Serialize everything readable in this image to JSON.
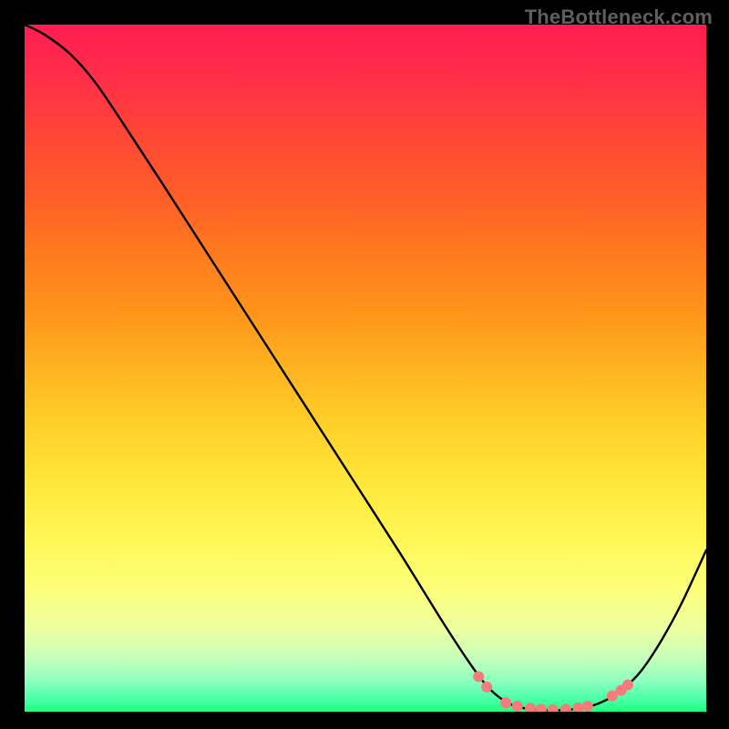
{
  "watermark": "TheBottleneck.com",
  "plot": {
    "x_extent": [
      0,
      748
    ],
    "y_extent": [
      0,
      754
    ]
  },
  "chart_data": {
    "type": "line",
    "title": "",
    "xlabel": "",
    "ylabel": "",
    "xlim": [
      0,
      100
    ],
    "ylim": [
      0,
      100
    ],
    "gradient_stops": [
      {
        "offset": 0.0,
        "color": "#ff1d52"
      },
      {
        "offset": 0.083,
        "color": "#ff2f47"
      },
      {
        "offset": 0.167,
        "color": "#ff4835"
      },
      {
        "offset": 0.25,
        "color": "#ff5e28"
      },
      {
        "offset": 0.333,
        "color": "#ff7a1e"
      },
      {
        "offset": 0.417,
        "color": "#ff941b"
      },
      {
        "offset": 0.5,
        "color": "#ffb321"
      },
      {
        "offset": 0.583,
        "color": "#ffd029"
      },
      {
        "offset": 0.667,
        "color": "#ffe73a"
      },
      {
        "offset": 0.75,
        "color": "#fff757"
      },
      {
        "offset": 0.82,
        "color": "#fdff78"
      },
      {
        "offset": 0.88,
        "color": "#ecffa0"
      },
      {
        "offset": 0.92,
        "color": "#c9ffba"
      },
      {
        "offset": 0.955,
        "color": "#8dffc0"
      },
      {
        "offset": 0.98,
        "color": "#4effaa"
      },
      {
        "offset": 1.0,
        "color": "#1eff81"
      }
    ],
    "curve_points": [
      {
        "x": 0.0,
        "y": 100.0
      },
      {
        "x": 3.0,
        "y": 98.5
      },
      {
        "x": 6.7,
        "y": 95.7
      },
      {
        "x": 10.2,
        "y": 91.8
      },
      {
        "x": 14.2,
        "y": 86.0
      },
      {
        "x": 20.0,
        "y": 77.2
      },
      {
        "x": 27.0,
        "y": 66.4
      },
      {
        "x": 34.0,
        "y": 55.6
      },
      {
        "x": 41.0,
        "y": 44.8
      },
      {
        "x": 48.0,
        "y": 34.0
      },
      {
        "x": 55.0,
        "y": 23.2
      },
      {
        "x": 61.0,
        "y": 13.6
      },
      {
        "x": 65.0,
        "y": 7.5
      },
      {
        "x": 67.6,
        "y": 4.0
      },
      {
        "x": 69.5,
        "y": 2.2
      },
      {
        "x": 71.5,
        "y": 1.0
      },
      {
        "x": 74.0,
        "y": 0.4
      },
      {
        "x": 77.0,
        "y": 0.2
      },
      {
        "x": 80.0,
        "y": 0.3
      },
      {
        "x": 83.0,
        "y": 0.8
      },
      {
        "x": 85.5,
        "y": 1.8
      },
      {
        "x": 88.0,
        "y": 3.5
      },
      {
        "x": 90.5,
        "y": 6.0
      },
      {
        "x": 93.5,
        "y": 10.5
      },
      {
        "x": 96.5,
        "y": 16.0
      },
      {
        "x": 100.0,
        "y": 23.5
      }
    ],
    "dot_points": [
      {
        "x": 66.6,
        "y": 5.1
      },
      {
        "x": 67.8,
        "y": 3.6
      },
      {
        "x": 70.6,
        "y": 1.3
      },
      {
        "x": 72.3,
        "y": 0.8
      },
      {
        "x": 74.2,
        "y": 0.5
      },
      {
        "x": 75.8,
        "y": 0.35
      },
      {
        "x": 77.5,
        "y": 0.3
      },
      {
        "x": 79.4,
        "y": 0.35
      },
      {
        "x": 81.2,
        "y": 0.55
      },
      {
        "x": 82.6,
        "y": 0.8
      },
      {
        "x": 86.2,
        "y": 2.3
      },
      {
        "x": 87.5,
        "y": 3.1
      },
      {
        "x": 88.5,
        "y": 3.9
      }
    ],
    "dot_radius_px": 6.0,
    "dot_color": "#f47c7c",
    "curve_stroke": "#000000",
    "curve_stroke_width": 2.4
  }
}
